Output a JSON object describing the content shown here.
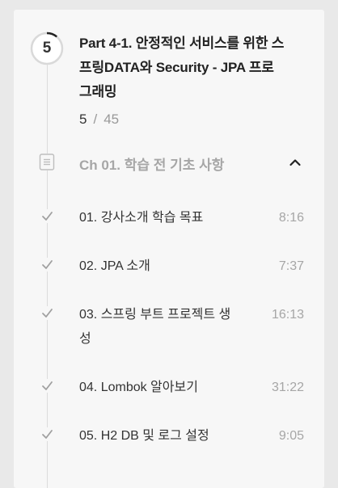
{
  "course": {
    "progress_number": "5",
    "title": "Part 4-1. 안정적인 서비스를 위한 스프링DATA와 Security - JPA 프로그래밍",
    "completed": "5",
    "separator": "/",
    "total": "45",
    "progress_fraction": 0.111
  },
  "chapter": {
    "title": "Ch 01. 학습 전 기초 사항",
    "icon": "document-icon",
    "expanded_icon": "chevron-up-icon"
  },
  "lessons": [
    {
      "title": "01. 강사소개 학습 목표",
      "duration": "8:16",
      "icon": "check-icon"
    },
    {
      "title": "02. JPA 소개",
      "duration": "7:37",
      "icon": "check-icon"
    },
    {
      "title": "03. 스프링 부트 프로젝트 생성",
      "duration": "16:13",
      "icon": "check-icon"
    },
    {
      "title": "04. Lombok 알아보기",
      "duration": "31:22",
      "icon": "check-icon"
    },
    {
      "title": "05. H2 DB 및 로그 설정",
      "duration": "9:05",
      "icon": "check-icon"
    }
  ],
  "colors": {
    "progress_track": "#d9d9d9",
    "progress_fill": "#222222",
    "check": "#a0a0a0",
    "muted_text": "#a6a6a6"
  }
}
